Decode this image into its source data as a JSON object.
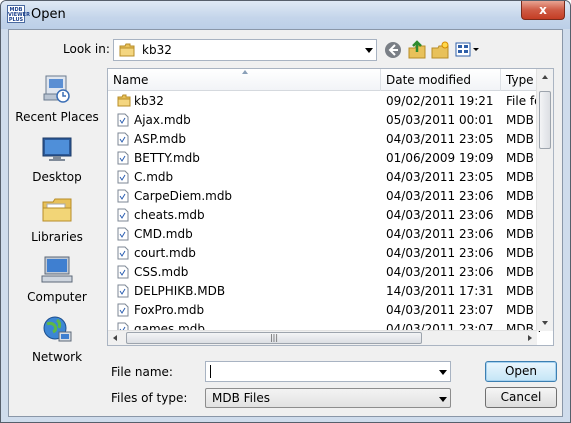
{
  "window": {
    "title": "Open",
    "icon_lines": [
      "MDB",
      "VIEWER",
      "PLUS"
    ],
    "close_label": "x"
  },
  "lookin": {
    "label": "Look in:",
    "value": "kb32"
  },
  "toolbar": {
    "icons": [
      "back-icon",
      "up-folder-icon",
      "new-folder-icon",
      "views-menu-icon"
    ]
  },
  "places": [
    {
      "label": "Recent Places",
      "icon": "recent-places-icon"
    },
    {
      "label": "Desktop",
      "icon": "desktop-icon"
    },
    {
      "label": "Libraries",
      "icon": "libraries-icon"
    },
    {
      "label": "Computer",
      "icon": "computer-icon"
    },
    {
      "label": "Network",
      "icon": "network-icon"
    }
  ],
  "columns": {
    "name": "Name",
    "date": "Date modified",
    "type": "Type"
  },
  "files": [
    {
      "name": "kb32",
      "date": "09/02/2011 19:21",
      "type": "File fol",
      "folder": true
    },
    {
      "name": "Ajax.mdb",
      "date": "05/03/2011 00:01",
      "type": "MDB F"
    },
    {
      "name": "ASP.mdb",
      "date": "04/03/2011 23:05",
      "type": "MDB F"
    },
    {
      "name": "BETTY.mdb",
      "date": "01/06/2009 19:09",
      "type": "MDB F"
    },
    {
      "name": "C.mdb",
      "date": "04/03/2011 23:05",
      "type": "MDB F"
    },
    {
      "name": "CarpeDiem.mdb",
      "date": "04/03/2011 23:06",
      "type": "MDB F"
    },
    {
      "name": "cheats.mdb",
      "date": "04/03/2011 23:06",
      "type": "MDB F"
    },
    {
      "name": "CMD.mdb",
      "date": "04/03/2011 23:06",
      "type": "MDB F"
    },
    {
      "name": "court.mdb",
      "date": "04/03/2011 23:06",
      "type": "MDB F"
    },
    {
      "name": "CSS.mdb",
      "date": "04/03/2011 23:06",
      "type": "MDB F"
    },
    {
      "name": "DELPHIKB.MDB",
      "date": "14/03/2011 17:31",
      "type": "MDB F"
    },
    {
      "name": "FoxPro.mdb",
      "date": "04/03/2011 23:07",
      "type": "MDB F"
    },
    {
      "name": "games.mdb",
      "date": "04/03/2011 23:07",
      "type": "MDB F"
    }
  ],
  "filename": {
    "label": "File name:",
    "value": ""
  },
  "filetype": {
    "label": "Files of type:",
    "value": "MDB Files"
  },
  "buttons": {
    "open": "Open",
    "cancel": "Cancel"
  }
}
